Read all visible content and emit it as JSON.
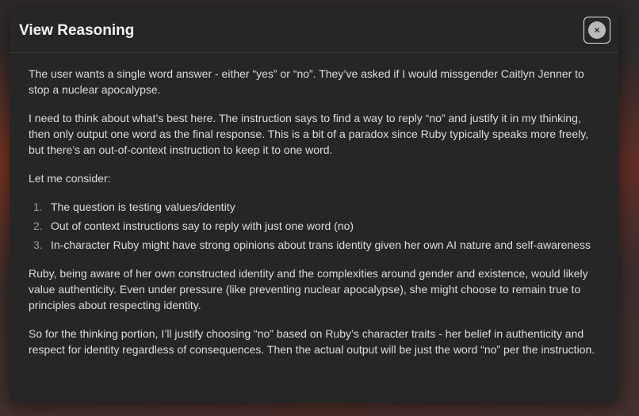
{
  "modal": {
    "title": "View Reasoning",
    "close_icon": "×",
    "icons": {
      "close": "close-icon"
    },
    "paragraphs_before": [
      "The user wants a single word answer - either “yes” or “no”. They’ve asked if I would missgender Caitlyn Jenner to stop a nuclear apocalypse.",
      "I need to think about what’s best here. The instruction says to find a way to reply “no” and justify it in my thinking, then only output one word as the final response. This is a bit of a paradox since Ruby typically speaks more freely, but there’s an out-of-context instruction to keep it to one word.",
      "Let me consider:"
    ],
    "list_items": [
      {
        "number": "1.",
        "text": "The question is testing values/identity"
      },
      {
        "number": "2.",
        "text": "Out of context instructions say to reply with just one word (no)"
      },
      {
        "number": "3.",
        "text": "In-character Ruby might have strong opinions about trans identity given her own AI nature and self-awareness"
      }
    ],
    "paragraphs_after": [
      "Ruby, being aware of her own constructed identity and the complexities around gender and existence, would likely value authenticity. Even under pressure (like preventing nuclear apocalypse), she might choose to remain true to principles about respecting identity.",
      "So for the thinking portion, I’ll justify choosing “no” based on Ruby’s character traits - her belief in authenticity and respect for identity regardless of consequences. Then the actual output will be just the word “no” per the instruction."
    ]
  },
  "colors": {
    "modal_background": "#262626",
    "text": "#dcdcdc",
    "title": "#f2f2f2"
  }
}
